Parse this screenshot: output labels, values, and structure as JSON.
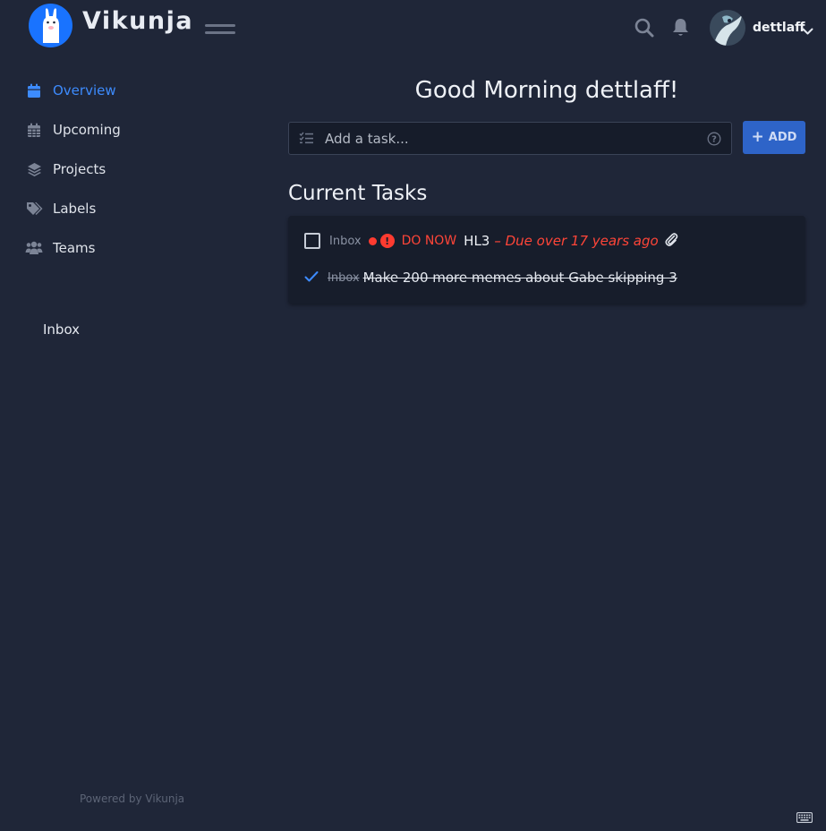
{
  "app": {
    "name": "Vikunja",
    "accent_color": "#3d8bfd",
    "logo_bg": "#1973ff"
  },
  "header": {
    "username": "dettlaff",
    "icons": [
      "menu-icon",
      "search-icon",
      "bell-icon",
      "chevron-down-icon"
    ]
  },
  "sidebar": {
    "items": [
      {
        "label": "Overview",
        "icon": "calendar-icon",
        "active": true
      },
      {
        "label": "Upcoming",
        "icon": "calendar-grid-icon",
        "active": false
      },
      {
        "label": "Projects",
        "icon": "layers-icon",
        "active": false
      },
      {
        "label": "Labels",
        "icon": "tags-icon",
        "active": false
      },
      {
        "label": "Teams",
        "icon": "users-icon",
        "active": false
      }
    ],
    "projects": [
      {
        "label": "Inbox"
      }
    ],
    "footer_prefix": "Powered by ",
    "footer_link": "Vikunja"
  },
  "main": {
    "greeting": "Good Morning dettlaff!",
    "add_task": {
      "placeholder": "Add a task...",
      "value": "",
      "button_label": "ADD"
    },
    "section_title": "Current Tasks",
    "tasks": [
      {
        "project": "Inbox",
        "priority_label": "DO NOW",
        "priority_symbol": "!",
        "title": "HL3",
        "due": "– Due over 17 years ago",
        "done": false,
        "has_attachment": true
      },
      {
        "project": "Inbox",
        "title": "Make 200 more memes about Gabe skipping 3",
        "done": true
      }
    ],
    "priority_color": "#ff3b30"
  }
}
